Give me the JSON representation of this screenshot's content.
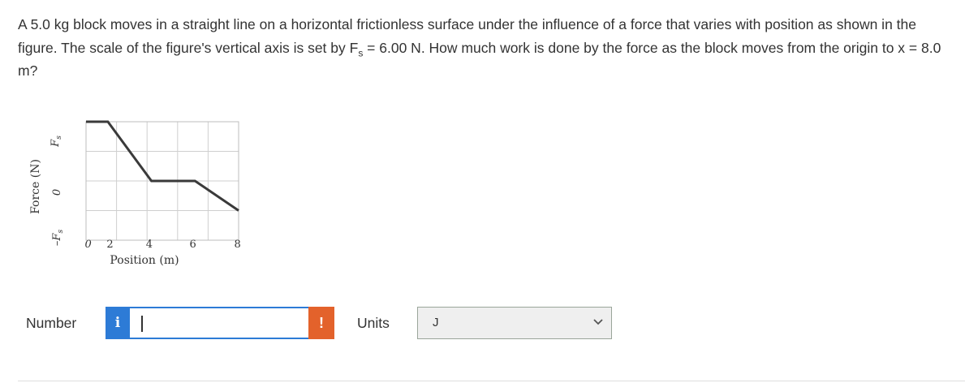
{
  "question": {
    "part1": "A 5.0 kg block moves in a straight line on a horizontal frictionless surface under the influence of a force that varies with position as shown in the figure. The scale of the figure's vertical axis is set by F",
    "sub": "s",
    "part2": " = 6.00 N. How much work is done by the force as the block moves from the origin to x = 8.0 m?"
  },
  "figure": {
    "ylabel": "Force (N)",
    "y_tick_top_main": "F",
    "y_tick_top_sub": "s",
    "y_tick_zero": "0",
    "y_tick_bottom_main": "–F",
    "y_tick_bottom_sub": "s",
    "xlabel": "Position (m)",
    "x_ticks": [
      "0",
      "2",
      "4",
      "6",
      "8"
    ]
  },
  "chart_data": {
    "type": "line",
    "xlabel": "Position (m)",
    "ylabel": "Force (N)",
    "x": [
      0,
      1,
      3,
      5,
      7
    ],
    "y": [
      1,
      1,
      0,
      0,
      -0.5
    ],
    "xlim": [
      0,
      7
    ],
    "ylim": [
      -1,
      1
    ],
    "grid": true
  },
  "answer": {
    "number_label": "Number",
    "info_icon": "i",
    "number_value": "",
    "alert_icon": "!",
    "units_label": "Units",
    "units_value": "J"
  },
  "colors": {
    "info": "#2d7bd6",
    "alert": "#e3622b",
    "select_bg": "#efefef"
  }
}
